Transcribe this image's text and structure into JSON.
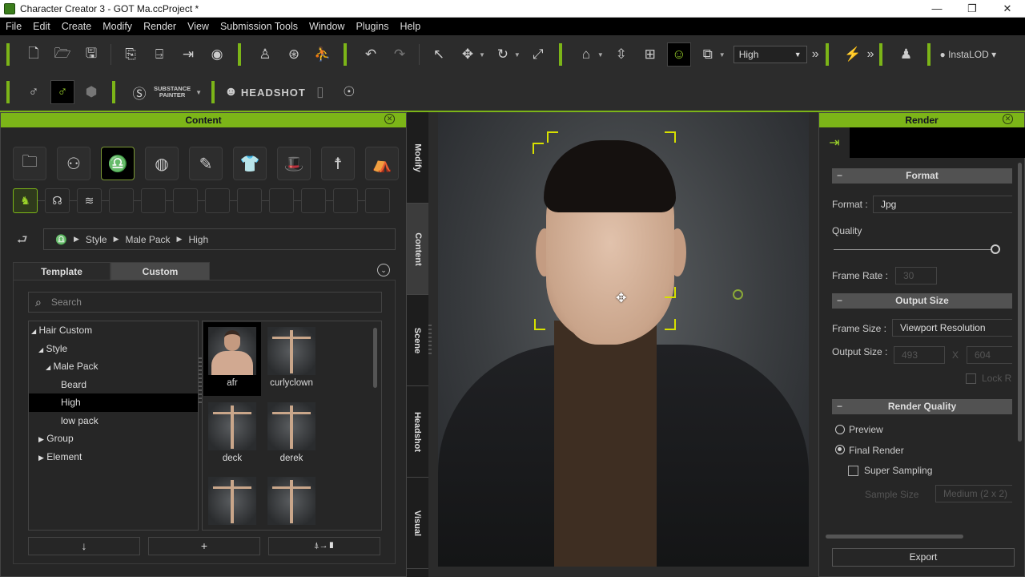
{
  "window": {
    "title": "Character Creator 3 - GOT Ma.ccProject *",
    "controls": [
      "minimize",
      "restore",
      "close"
    ]
  },
  "menu": [
    "File",
    "Edit",
    "Create",
    "Modify",
    "Render",
    "View",
    "Submission Tools",
    "Window",
    "Plugins",
    "Help"
  ],
  "toolbar": {
    "quality_select": "High",
    "instalod_label": "InstaLOD",
    "substance_line1": "SUBSTANCE",
    "substance_line2": "PAINTER",
    "headshot_label": "HEADSHOT"
  },
  "content_panel": {
    "title": "Content",
    "breadcrumb": [
      "Style",
      "Male Pack",
      "High"
    ],
    "tabs": [
      {
        "label": "Template",
        "selected": false
      },
      {
        "label": "Custom",
        "selected": true
      }
    ],
    "search_placeholder": "Search",
    "tree": [
      {
        "label": "Hair Custom",
        "level": 0,
        "expander": "open"
      },
      {
        "label": "Style",
        "level": 1,
        "expander": "open"
      },
      {
        "label": "Male Pack",
        "level": 2,
        "expander": "open"
      },
      {
        "label": "Beard",
        "level": 3,
        "expander": "none"
      },
      {
        "label": "High",
        "level": 3,
        "expander": "none",
        "selected": true
      },
      {
        "label": "low pack",
        "level": 3,
        "expander": "none"
      },
      {
        "label": "Group",
        "level": 1,
        "expander": "closed"
      },
      {
        "label": "Element",
        "level": 1,
        "expander": "closed"
      }
    ],
    "items": [
      {
        "label": "afr",
        "selected": true,
        "kind": "bust"
      },
      {
        "label": "curlyclown",
        "kind": "tpose"
      },
      {
        "label": "deck",
        "kind": "tpose"
      },
      {
        "label": "derek",
        "kind": "tpose"
      },
      {
        "label": "",
        "kind": "tpose"
      },
      {
        "label": "",
        "kind": "tpose"
      }
    ],
    "actions": [
      "↓",
      "+",
      "⍋→▮"
    ]
  },
  "side_tabs": [
    {
      "label": "Modify",
      "selected": false
    },
    {
      "label": "Content",
      "selected": true
    },
    {
      "label": "Scene",
      "selected": false
    },
    {
      "label": "Headshot",
      "selected": false
    },
    {
      "label": "Visual",
      "selected": false
    }
  ],
  "render_panel": {
    "title": "Render",
    "format_section": "Format",
    "format_label": "Format :",
    "format_value": "Jpg",
    "quality_label": "Quality",
    "quality_value": 1.0,
    "frame_rate_label": "Frame Rate :",
    "frame_rate_value": "30",
    "output_section": "Output Size",
    "frame_size_label": "Frame Size :",
    "frame_size_value": "Viewport Resolution",
    "output_size_label": "Output Size :",
    "output_width": "493",
    "output_height": "604",
    "x_label": "X",
    "lock_label": "Lock R",
    "quality_section": "Render Quality",
    "preview_label": "Preview",
    "final_label": "Final Render",
    "final_selected": true,
    "super_label": "Super Sampling",
    "sample_size_label": "Sample Size",
    "sample_size_value": "Medium (2 x 2)",
    "export_label": "Export"
  },
  "colors": {
    "accent": "#7cb518",
    "selection_bracket": "#d7e000"
  }
}
